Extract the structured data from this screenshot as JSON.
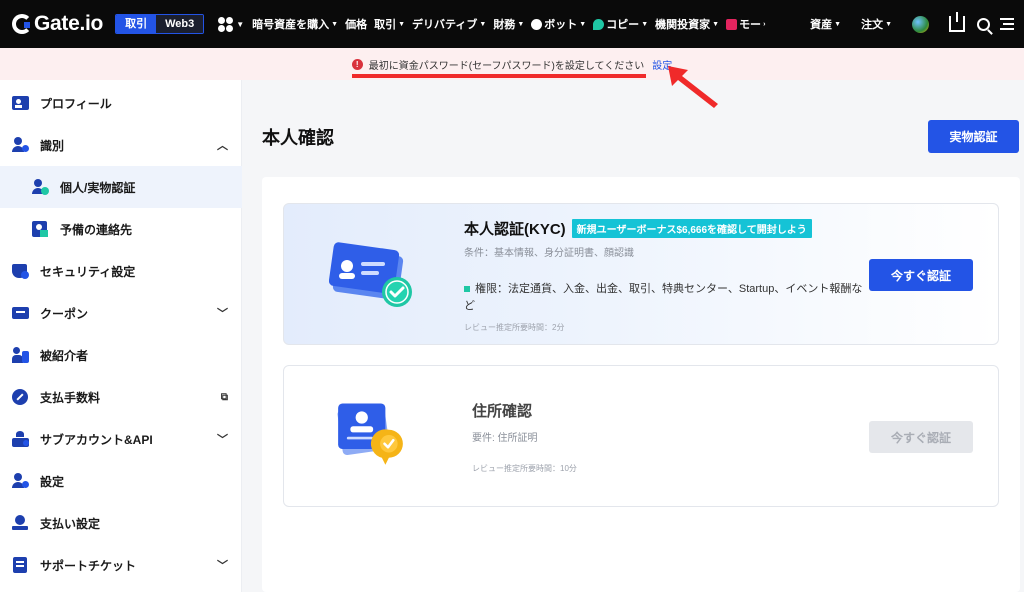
{
  "header": {
    "brand": "Gate.io",
    "mode_switch": [
      "取引",
      "Web3"
    ],
    "nav": [
      {
        "label": "暗号資産を購入",
        "caret": true
      },
      {
        "label": "価格",
        "caret": false
      },
      {
        "label": "取引",
        "caret": true
      },
      {
        "label": "デリバティブ",
        "caret": true
      },
      {
        "label": "財務",
        "caret": true
      },
      {
        "label": "ボット",
        "caret": true
      },
      {
        "label": "コピー",
        "caret": true
      },
      {
        "label": "機関投資家",
        "caret": true
      },
      {
        "label": "モー",
        "caret": false
      }
    ],
    "right_menu": [
      "資産",
      "注文"
    ]
  },
  "notice": {
    "text": "最初に資金パスワード(セーフパスワード)を設定してください",
    "link": "設定"
  },
  "sidebar": {
    "items": [
      {
        "label": "プロフィール",
        "icon": "profile-icon"
      },
      {
        "label": "識別",
        "icon": "identity-icon",
        "chevron": "up"
      },
      {
        "label": "個人/実物認証",
        "icon": "verified-user-icon",
        "sub": true,
        "active": true
      },
      {
        "label": "予備の連絡先",
        "icon": "contact-icon",
        "sub": true
      },
      {
        "label": "セキュリティ設定",
        "icon": "security-icon"
      },
      {
        "label": "クーポン",
        "icon": "coupon-icon",
        "chevron": "down"
      },
      {
        "label": "被紹介者",
        "icon": "referral-icon"
      },
      {
        "label": "支払手数料",
        "icon": "fee-icon",
        "external": true
      },
      {
        "label": "サブアカウント&API",
        "icon": "subaccount-icon",
        "chevron": "down"
      },
      {
        "label": "設定",
        "icon": "settings-icon"
      },
      {
        "label": "支払い設定",
        "icon": "payment-icon"
      },
      {
        "label": "サポートチケット",
        "icon": "ticket-icon",
        "chevron": "down"
      }
    ]
  },
  "main": {
    "title": "本人確認",
    "entity_button": "実物認証",
    "kyc_card": {
      "title": "本人認証(KYC)",
      "badge": "新規ユーザーボーナス$6,666を確認して開封しよう",
      "conditions": "条件：基本情報、身分証明書、顔認識",
      "permissions": "権限：法定通貨、入金、出金、取引、特典センター、Startup、イベント報酬など",
      "review_time": "レビュー推定所要時間：2分",
      "button": "今すぐ認証"
    },
    "address_card": {
      "title": "住所確認",
      "requirements": "要件: 住所証明",
      "review_time": "レビュー推定所要時間：10分",
      "button": "今すぐ認証"
    }
  },
  "colors": {
    "brand_blue": "#2354e6",
    "notice_bg": "#fdeff0",
    "annotation_red": "#f02a2a",
    "badge_cyan": "#15c3d6"
  }
}
